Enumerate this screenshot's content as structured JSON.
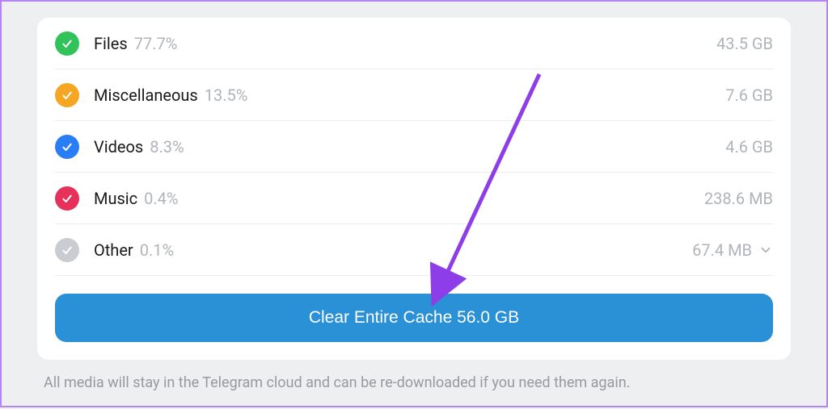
{
  "categories": [
    {
      "label": "Files",
      "percent": "77.7%",
      "size": "43.5 GB",
      "color": "#31c25a",
      "expandable": false
    },
    {
      "label": "Miscellaneous",
      "percent": "13.5%",
      "size": "7.6 GB",
      "color": "#f5a623",
      "expandable": false
    },
    {
      "label": "Videos",
      "percent": "8.3%",
      "size": "4.6 GB",
      "color": "#2a7ef5",
      "expandable": false
    },
    {
      "label": "Music",
      "percent": "0.4%",
      "size": "238.6 MB",
      "color": "#e6325a",
      "expandable": false
    },
    {
      "label": "Other",
      "percent": "0.1%",
      "size": "67.4 MB",
      "color": "#c9ccd0",
      "expandable": true
    }
  ],
  "clear_button_label": "Clear Entire Cache 56.0 GB",
  "footer_text": "All media will stay in the Telegram cloud and can be re-downloaded if you need them again.",
  "annotation": {
    "arrow_color": "#8e3ee8"
  }
}
